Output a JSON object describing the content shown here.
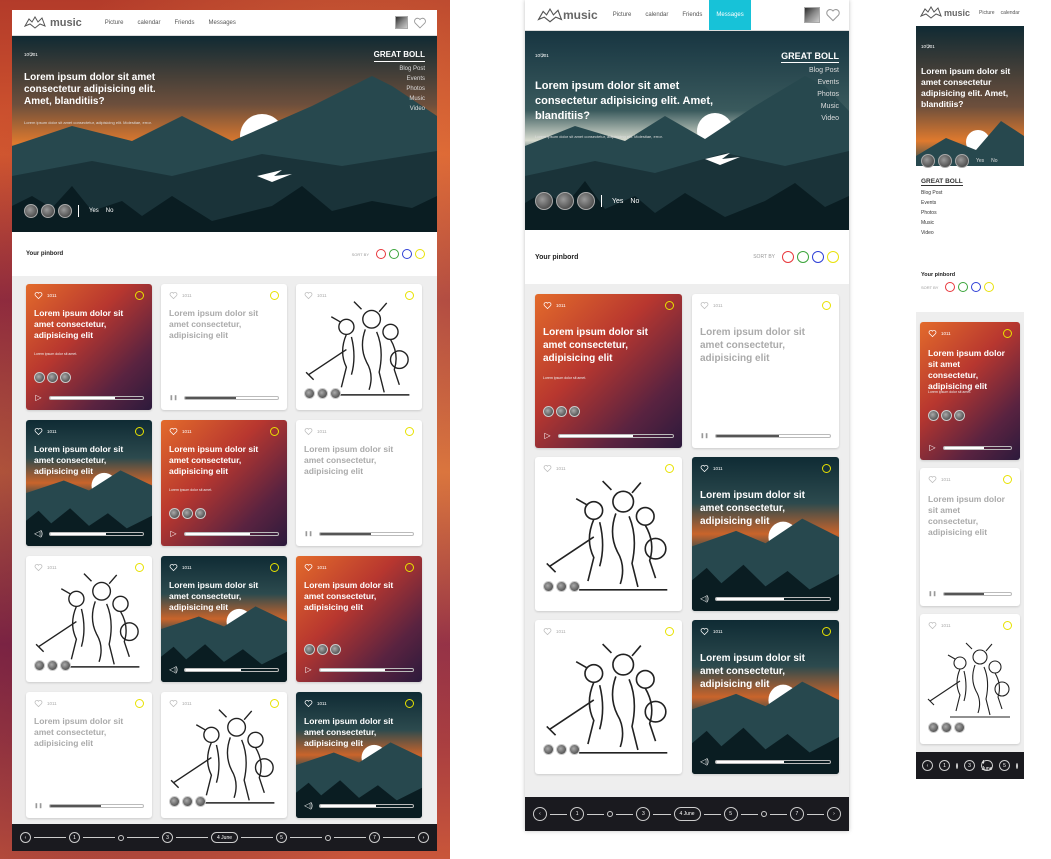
{
  "app": {
    "logo_text": "music",
    "nav_full": [
      "Picture",
      "calendar",
      "Friends",
      "Messages"
    ],
    "nav_short": [
      "Picture",
      "calendar"
    ],
    "active_nav": "Messages"
  },
  "hero": {
    "likes": "10 201",
    "title": "Lorem ipsum dolor sit amet consectetur adipisicing elit. Amet, blanditiis?",
    "subtitle": "Lorem ipsum dolor sit amet consectetur, adipisicing elit. Molestiae, error.",
    "menu_head": "GREAT BOLL",
    "menu": [
      "Blog Post",
      "Events",
      "Photos",
      "Music",
      "Video"
    ],
    "yes": "Yes",
    "no": "No"
  },
  "pinboard": {
    "title": "Your pinbord",
    "sort_label": "SORT BY",
    "sort_colors": [
      "#e8363b",
      "#3aa43a",
      "#2e3fd6",
      "#e9e20a"
    ]
  },
  "card": {
    "likes": "1011",
    "title": "Lorem ipsum dolor sit amet consectetur, adipisicing elit",
    "sub": "Lorem ipsum dolor sit amet."
  },
  "pager": {
    "prev": "‹",
    "next": "›",
    "pages": [
      "1",
      "3",
      "4 June",
      "5",
      "7"
    ]
  },
  "colors": {
    "accent": "#17c2d8",
    "yellow_ring": "#e8e200"
  }
}
